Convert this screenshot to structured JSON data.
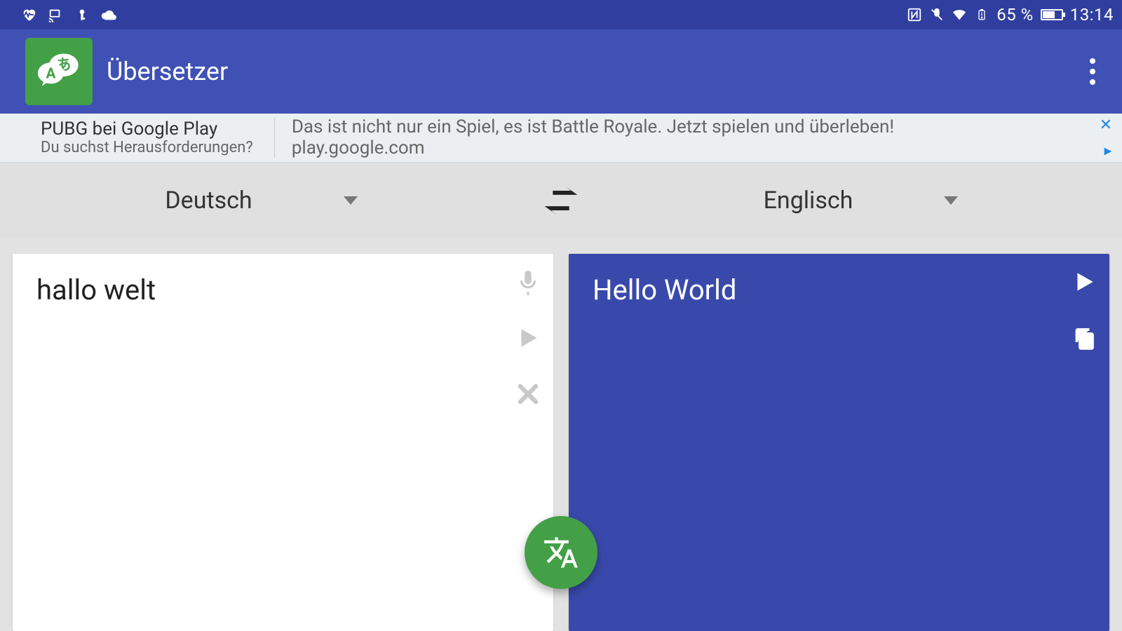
{
  "status_bar": {
    "battery_text": "65 %",
    "clock": "13:14"
  },
  "app": {
    "title": "Übersetzer"
  },
  "ad": {
    "title": "PUBG bei Google Play",
    "subtitle": "Du suchst Herausforderungen?",
    "body": "Das ist nicht nur ein Spiel, es ist Battle Royale. Jetzt spielen und überleben!",
    "url": "play.google.com"
  },
  "languages": {
    "source": "Deutsch",
    "target": "Englisch"
  },
  "input": {
    "text": "hallo welt"
  },
  "output": {
    "text": "Hello World"
  },
  "colors": {
    "primary": "#3f51b5",
    "primary_dark": "#303f9f",
    "output_panel": "#3949ab",
    "accent_green": "#43a047"
  }
}
